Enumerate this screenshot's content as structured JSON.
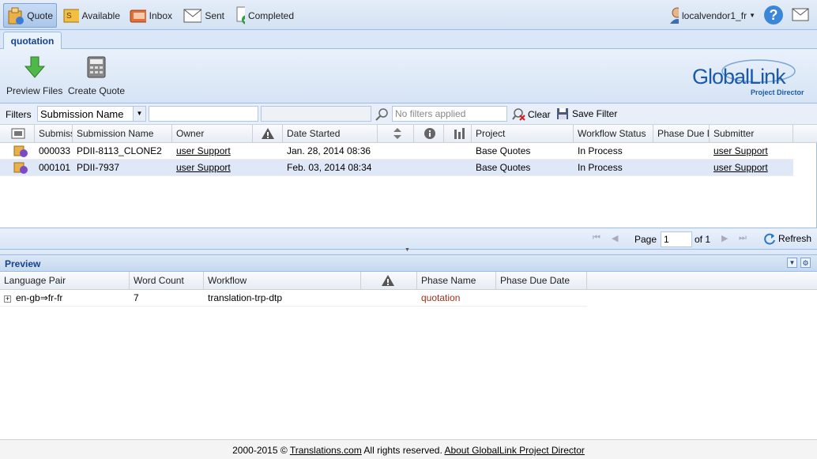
{
  "nav": {
    "quote": "Quote",
    "available": "Available",
    "inbox": "Inbox",
    "sent": "Sent",
    "completed": "Completed",
    "user": "localvendor1_fr"
  },
  "tab": "quotation",
  "toolbar": {
    "preview_files": "Preview Files",
    "create_quote": "Create Quote",
    "logo_main": "GlobalLink",
    "logo_sub": "Project Director"
  },
  "filters": {
    "label": "Filters",
    "field_select": "Submission Name",
    "text_value": "",
    "placeholder": "No filters applied",
    "clear": "Clear",
    "save": "Save Filter"
  },
  "grid": {
    "columns": [
      "Submission",
      "Submission Name",
      "Owner",
      "Date Started",
      "Project",
      "Workflow Status",
      "Phase Due Date",
      "Submitter"
    ],
    "rows": [
      {
        "id": "000033",
        "name": "PDII-8113_CLONE2",
        "owner": "user Support",
        "date": "Jan. 28, 2014 08:36",
        "project": "Base Quotes",
        "status": "In Process",
        "submitter": "user Support"
      },
      {
        "id": "000101",
        "name": "PDII-7937",
        "owner": "user Support",
        "date": "Feb. 03, 2014 08:34",
        "project": "Base Quotes",
        "status": "In Process",
        "submitter": "user Support"
      }
    ]
  },
  "pager": {
    "page_label": "Page",
    "page_value": "1",
    "of": "of 1",
    "refresh": "Refresh"
  },
  "preview": {
    "title": "Preview",
    "columns": [
      "Language Pair",
      "Word Count",
      "Workflow",
      "Phase Name",
      "Phase Due Date"
    ],
    "rows": [
      {
        "pair": "en-gb⇒fr-fr",
        "count": "7",
        "workflow": "translation-trp-dtp",
        "phase": "quotation",
        "due": ""
      }
    ]
  },
  "footer": {
    "copy": "2000-2015 ©",
    "link1": "Translations.com",
    "rights": "All rights reserved.",
    "link2": "About GlobalLink Project Director"
  },
  "colors": {
    "accent": "#15428b",
    "phase": "#a0301a"
  }
}
